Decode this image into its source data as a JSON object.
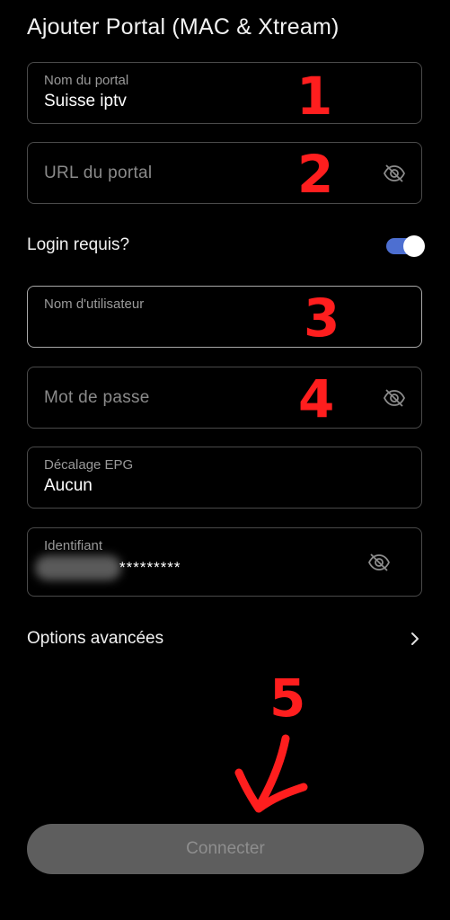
{
  "header": {
    "title": "Ajouter Portal (MAC & Xtream)"
  },
  "fields": {
    "portal_name": {
      "label": "Nom du portal",
      "value": "Suisse iptv"
    },
    "portal_url": {
      "placeholder": "URL du portal"
    },
    "login_required": {
      "label": "Login requis?",
      "enabled": true
    },
    "username": {
      "label": "Nom d'utilisateur",
      "value": ""
    },
    "password": {
      "placeholder": "Mot de passe"
    },
    "epg_offset": {
      "label": "Décalage EPG",
      "value": "Aucun"
    },
    "identifier": {
      "label": "Identifiant",
      "masked_value": "*********"
    }
  },
  "advanced": {
    "label": "Options avancées"
  },
  "connect": {
    "label": "Connecter"
  },
  "annotations": {
    "n1": "1",
    "n2": "2",
    "n3": "3",
    "n4": "4",
    "n5": "5"
  },
  "colors": {
    "background": "#000000",
    "toggle_accent": "#4d6fd1",
    "annotation": "#ff1e1e",
    "button_disabled": "#5e5e5e"
  },
  "icons": {
    "visibility": "eye-off-icon",
    "advanced": "chevron-right-icon"
  }
}
